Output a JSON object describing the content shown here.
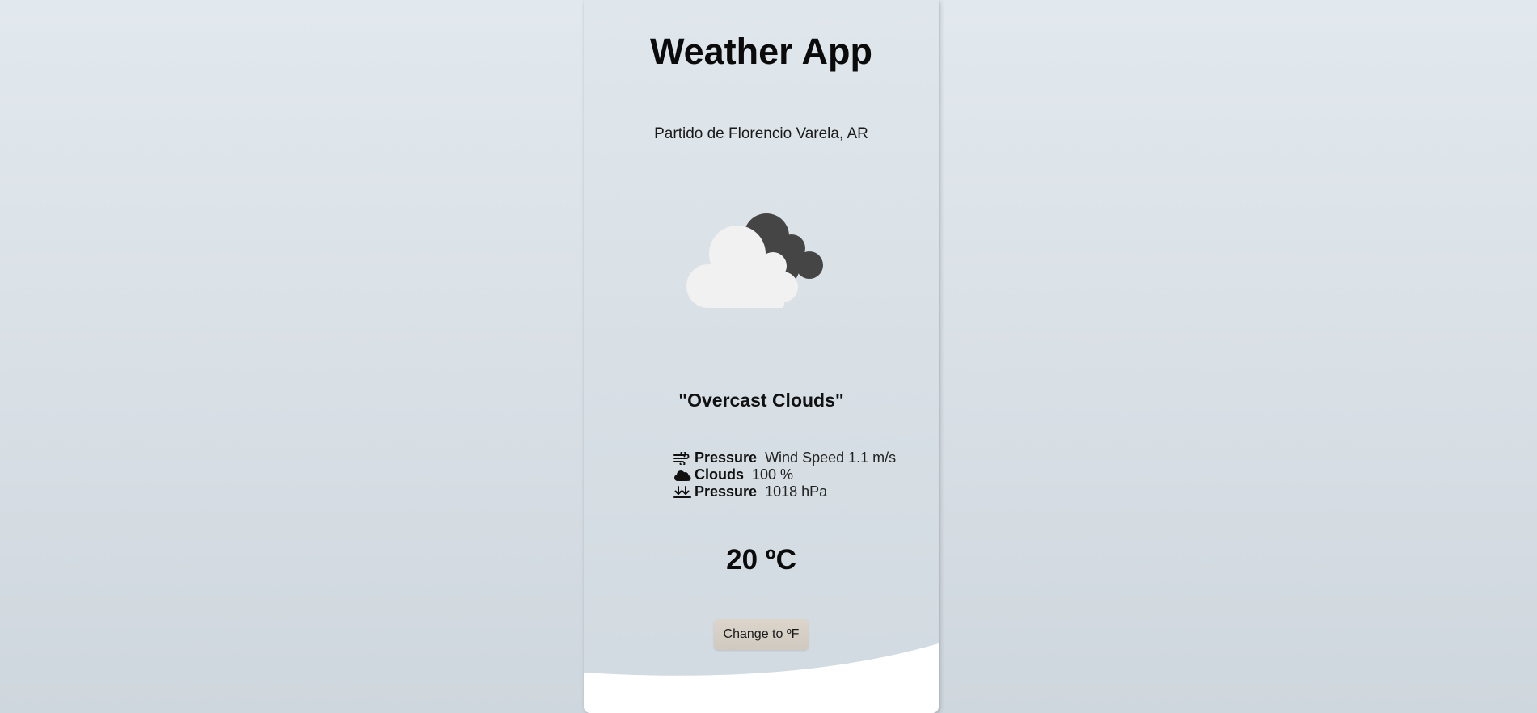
{
  "app": {
    "title": "Weather App"
  },
  "location": "Partido de Florencio Varela, AR",
  "weather": {
    "icon": "overcast-clouds-icon",
    "description": "\"Overcast Clouds\""
  },
  "details": [
    {
      "icon": "wind-icon",
      "label": "Pressure",
      "value": "Wind Speed 1.1 m/s"
    },
    {
      "icon": "cloud-icon",
      "label": "Clouds",
      "value": "100 %"
    },
    {
      "icon": "pressure-icon",
      "label": "Pressure",
      "value": "1018 hPa"
    }
  ],
  "temperature": "20 ºC",
  "toggle_label": "Change to ºF",
  "colors": {
    "cloud_front": "#f1f1f1",
    "cloud_back": "#454545",
    "button_bg": "#d6cfc5"
  }
}
